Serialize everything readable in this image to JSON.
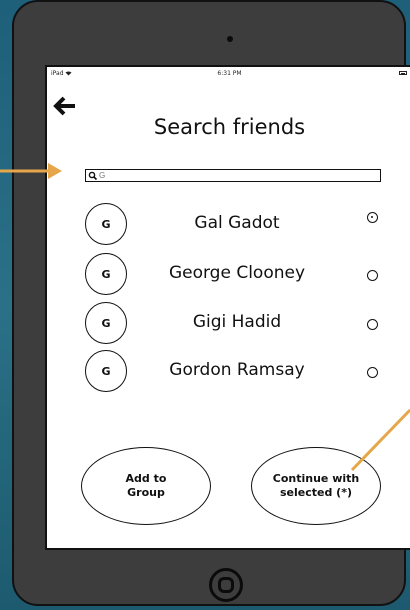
{
  "status_bar": {
    "device": "iPad",
    "time": "6:31 PM"
  },
  "header": {
    "title": "Search friends"
  },
  "search": {
    "value": "G"
  },
  "friends": [
    {
      "initial": "G",
      "name": "Gal Gadot",
      "selected": true
    },
    {
      "initial": "G",
      "name": "George Clooney",
      "selected": false
    },
    {
      "initial": "G",
      "name": "Gigi Hadid",
      "selected": false
    },
    {
      "initial": "G",
      "name": "Gordon Ramsay",
      "selected": false
    }
  ],
  "actions": {
    "add_to_group": "Add to\nGroup",
    "continue_selected": "Continue with\nselected (*)"
  },
  "colors": {
    "background": "#23657c",
    "tablet_frame": "#3d3d3d",
    "callout_arrow": "#e6a64a",
    "screen": "#ffffff"
  }
}
